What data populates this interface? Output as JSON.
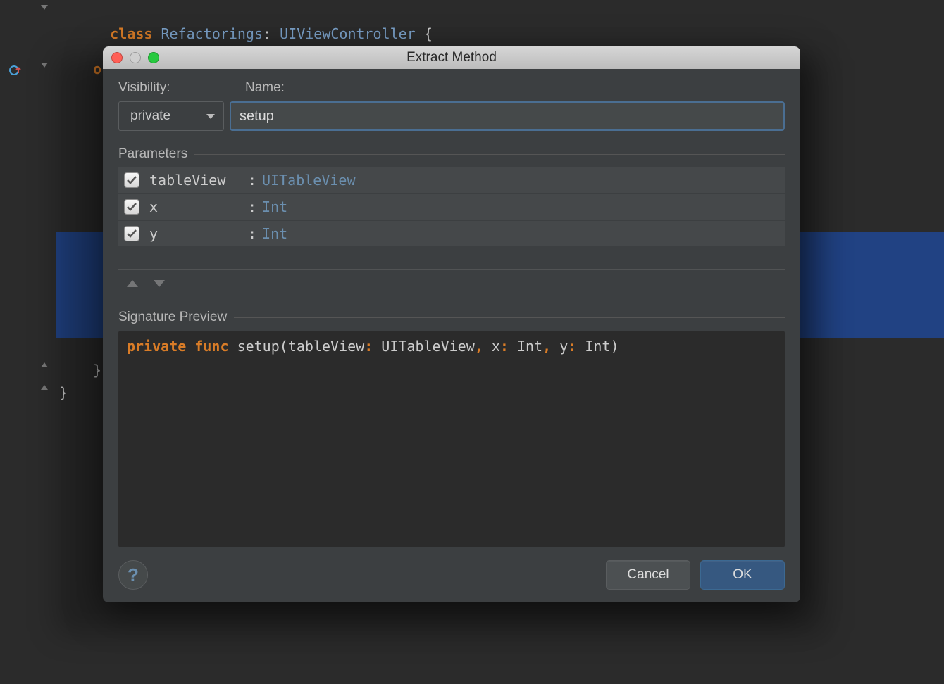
{
  "editor": {
    "line_class": {
      "kw": "class",
      "name": "Refactorings",
      "colon": ":",
      "super": "UIViewController",
      "brace": "{"
    },
    "line_override_fragment": "o",
    "line_close_method": "}",
    "line_close_class": "}"
  },
  "dialog": {
    "title": "Extract Method",
    "labels": {
      "visibility": "Visibility:",
      "name": "Name:",
      "parameters": "Parameters",
      "signature_preview": "Signature Preview"
    },
    "visibility_value": "private",
    "name_value": "setup",
    "parameters": [
      {
        "checked": true,
        "name": "tableView",
        "type": "UITableView"
      },
      {
        "checked": true,
        "name": "x",
        "type": "Int"
      },
      {
        "checked": true,
        "name": "y",
        "type": "Int"
      }
    ],
    "signature": {
      "kw1": "private",
      "kw2": "func",
      "fn": "setup",
      "rest_1": "(tableView",
      "rest_2": " UITableView",
      "rest_3": " x",
      "rest_4": " Int",
      "rest_5": " y",
      "rest_6": " Int)",
      "colon": ":",
      "comma": ","
    },
    "buttons": {
      "help": "?",
      "cancel": "Cancel",
      "ok": "OK"
    }
  }
}
